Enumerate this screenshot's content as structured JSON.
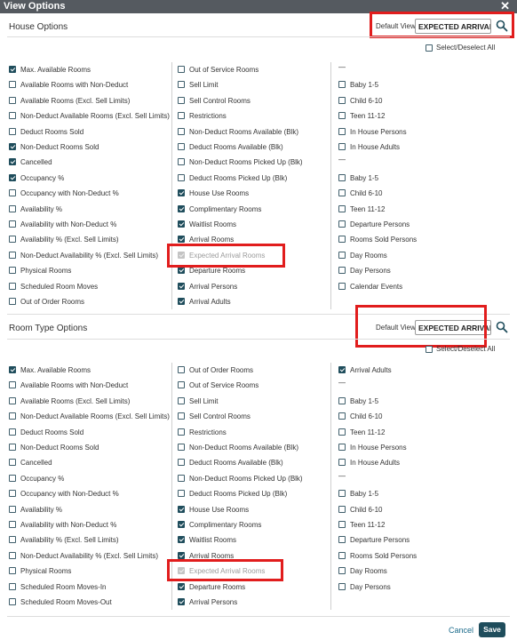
{
  "dialog": {
    "title": "View Options",
    "close_glyph": "✕"
  },
  "house": {
    "title": "House Options",
    "default_view_label": "Default View",
    "default_view_value": "EXPECTED ARRIVAL RO",
    "select_all_label": "Select/Deselect All",
    "col1": [
      {
        "label": "Max. Available Rooms",
        "state": "checked"
      },
      {
        "label": "Available Rooms with Non-Deduct",
        "state": "unchecked"
      },
      {
        "label": "Available Rooms (Excl. Sell Limits)",
        "state": "unchecked"
      },
      {
        "label": "Non-Deduct Available Rooms (Excl. Sell Limits)",
        "state": "unchecked"
      },
      {
        "label": "Deduct Rooms Sold",
        "state": "unchecked"
      },
      {
        "label": "Non-Deduct Rooms Sold",
        "state": "checked"
      },
      {
        "label": "Cancelled",
        "state": "checked"
      },
      {
        "label": "Occupancy %",
        "state": "checked"
      },
      {
        "label": "Occupancy with Non-Deduct %",
        "state": "unchecked"
      },
      {
        "label": "Availability %",
        "state": "unchecked"
      },
      {
        "label": "Availability with Non-Deduct %",
        "state": "unchecked"
      },
      {
        "label": "Availability % (Excl. Sell Limits)",
        "state": "unchecked"
      },
      {
        "label": "Non-Deduct Availability % (Excl. Sell Limits)",
        "state": "unchecked"
      },
      {
        "label": "Physical Rooms",
        "state": "unchecked"
      },
      {
        "label": "Scheduled Room Moves",
        "state": "unchecked"
      },
      {
        "label": "Out of Order Rooms",
        "state": "unchecked"
      }
    ],
    "col2": [
      {
        "label": "Out of Service Rooms",
        "state": "unchecked"
      },
      {
        "label": "Sell Limit",
        "state": "unchecked"
      },
      {
        "label": "Sell Control Rooms",
        "state": "unchecked"
      },
      {
        "label": "Restrictions",
        "state": "unchecked"
      },
      {
        "label": "Non-Deduct Rooms Available (Blk)",
        "state": "unchecked"
      },
      {
        "label": "Deduct Rooms Available (Blk)",
        "state": "unchecked"
      },
      {
        "label": "Non-Deduct Rooms Picked Up (Blk)",
        "state": "unchecked"
      },
      {
        "label": "Deduct Rooms Picked Up (Blk)",
        "state": "unchecked"
      },
      {
        "label": "House Use Rooms",
        "state": "checked"
      },
      {
        "label": "Complimentary Rooms",
        "state": "checked"
      },
      {
        "label": "Waitlist Rooms",
        "state": "checked"
      },
      {
        "label": "Arrival Rooms",
        "state": "checked"
      },
      {
        "label": "Expected Arrival Rooms",
        "state": "disabled"
      },
      {
        "label": "Departure Rooms",
        "state": "checked"
      },
      {
        "label": "Arrival Persons",
        "state": "checked"
      },
      {
        "label": "Arrival Adults",
        "state": "checked"
      }
    ],
    "col3": [
      {
        "kind": "dash",
        "label": "—"
      },
      {
        "label": "Baby 1-5",
        "state": "unchecked"
      },
      {
        "label": "Child 6-10",
        "state": "unchecked"
      },
      {
        "label": "Teen 11-12",
        "state": "unchecked"
      },
      {
        "label": "In House Persons",
        "state": "unchecked"
      },
      {
        "label": "In House Adults",
        "state": "unchecked"
      },
      {
        "kind": "dash",
        "label": "—"
      },
      {
        "label": "Baby 1-5",
        "state": "unchecked"
      },
      {
        "label": "Child 6-10",
        "state": "unchecked"
      },
      {
        "label": "Teen 11-12",
        "state": "unchecked"
      },
      {
        "label": "Departure Persons",
        "state": "unchecked"
      },
      {
        "label": "Rooms Sold Persons",
        "state": "unchecked"
      },
      {
        "label": "Day Rooms",
        "state": "unchecked"
      },
      {
        "label": "Day Persons",
        "state": "unchecked"
      },
      {
        "label": "Calendar Events",
        "state": "unchecked"
      }
    ]
  },
  "roomtype": {
    "title": "Room Type Options",
    "default_view_label": "Default View",
    "default_view_value": "EXPECTED ARRIVAL RO",
    "select_all_label": "Select/Deselect All",
    "col1": [
      {
        "label": "Max. Available Rooms",
        "state": "checked"
      },
      {
        "label": "Available Rooms with Non-Deduct",
        "state": "unchecked"
      },
      {
        "label": "Available Rooms (Excl. Sell Limits)",
        "state": "unchecked"
      },
      {
        "label": "Non-Deduct Available Rooms (Excl. Sell Limits)",
        "state": "unchecked"
      },
      {
        "label": "Deduct Rooms Sold",
        "state": "unchecked"
      },
      {
        "label": "Non-Deduct Rooms Sold",
        "state": "unchecked"
      },
      {
        "label": "Cancelled",
        "state": "unchecked"
      },
      {
        "label": "Occupancy %",
        "state": "unchecked"
      },
      {
        "label": "Occupancy with Non-Deduct %",
        "state": "unchecked"
      },
      {
        "label": "Availability %",
        "state": "unchecked"
      },
      {
        "label": "Availability with Non-Deduct %",
        "state": "unchecked"
      },
      {
        "label": "Availability % (Excl. Sell Limits)",
        "state": "unchecked"
      },
      {
        "label": "Non-Deduct Availability % (Excl. Sell Limits)",
        "state": "unchecked"
      },
      {
        "label": "Physical Rooms",
        "state": "unchecked"
      },
      {
        "label": "Scheduled Room Moves-In",
        "state": "unchecked"
      },
      {
        "label": "Scheduled Room Moves-Out",
        "state": "unchecked"
      }
    ],
    "col2": [
      {
        "label": "Out of Order Rooms",
        "state": "unchecked"
      },
      {
        "label": "Out of Service Rooms",
        "state": "unchecked"
      },
      {
        "label": "Sell Limit",
        "state": "unchecked"
      },
      {
        "label": "Sell Control Rooms",
        "state": "unchecked"
      },
      {
        "label": "Restrictions",
        "state": "unchecked"
      },
      {
        "label": "Non-Deduct Rooms Available (Blk)",
        "state": "unchecked"
      },
      {
        "label": "Deduct Rooms Available (Blk)",
        "state": "unchecked"
      },
      {
        "label": "Non-Deduct Rooms Picked Up (Blk)",
        "state": "unchecked"
      },
      {
        "label": "Deduct Rooms Picked Up (Blk)",
        "state": "unchecked"
      },
      {
        "label": "House Use Rooms",
        "state": "checked"
      },
      {
        "label": "Complimentary Rooms",
        "state": "checked"
      },
      {
        "label": "Waitlist Rooms",
        "state": "checked"
      },
      {
        "label": "Arrival Rooms",
        "state": "checked"
      },
      {
        "label": "Expected Arrival Rooms",
        "state": "disabled"
      },
      {
        "label": "Departure Rooms",
        "state": "checked"
      },
      {
        "label": "Arrival Persons",
        "state": "checked"
      }
    ],
    "col3": [
      {
        "label": "Arrival Adults",
        "state": "checked"
      },
      {
        "kind": "dash",
        "label": "—"
      },
      {
        "label": "Baby 1-5",
        "state": "unchecked"
      },
      {
        "label": "Child 6-10",
        "state": "unchecked"
      },
      {
        "label": "Teen 11-12",
        "state": "unchecked"
      },
      {
        "label": "In House Persons",
        "state": "unchecked"
      },
      {
        "label": "In House Adults",
        "state": "unchecked"
      },
      {
        "kind": "dash",
        "label": "—"
      },
      {
        "label": "Baby 1-5",
        "state": "unchecked"
      },
      {
        "label": "Child 6-10",
        "state": "unchecked"
      },
      {
        "label": "Teen 11-12",
        "state": "unchecked"
      },
      {
        "label": "Departure Persons",
        "state": "unchecked"
      },
      {
        "label": "Rooms Sold Persons",
        "state": "unchecked"
      },
      {
        "label": "Day Rooms",
        "state": "unchecked"
      },
      {
        "label": "Day Persons",
        "state": "unchecked"
      }
    ]
  },
  "footer": {
    "cancel_label": "Cancel",
    "save_label": "Save"
  },
  "colors": {
    "accent": "#1f4d5c",
    "highlight": "#e11d1d",
    "titlebar": "#555a60"
  }
}
